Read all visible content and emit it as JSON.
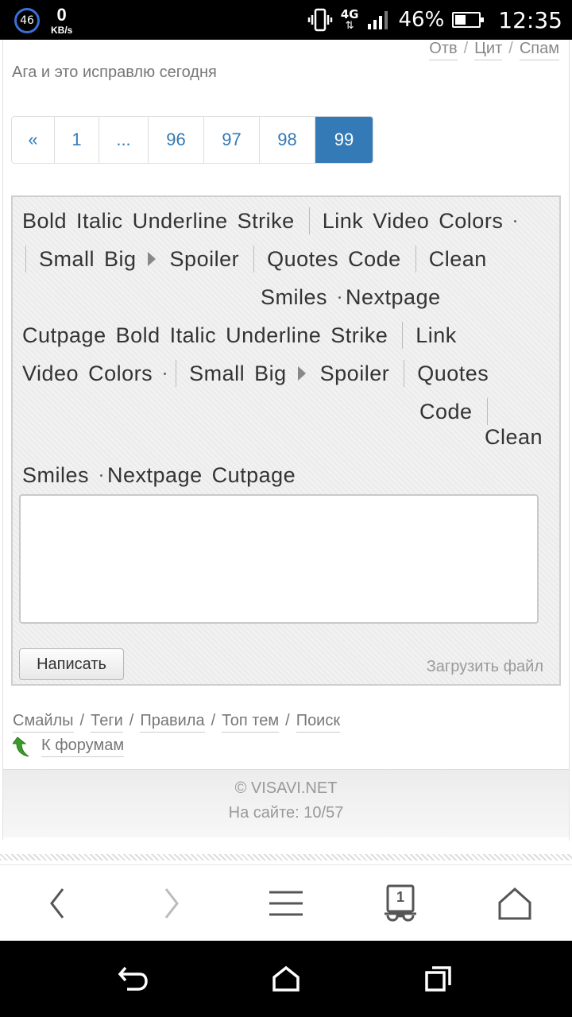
{
  "status_bar": {
    "notification_count": "46",
    "net_speed_value": "0",
    "net_speed_unit": "KB/s",
    "network_label": "4G",
    "battery_percent": "46%",
    "battery_level": 0.46,
    "time": "12:35"
  },
  "post": {
    "actions": [
      "Отв",
      "Цит",
      "Спам"
    ],
    "text": "Ага и это исправлю сегодня"
  },
  "pagination": {
    "items": [
      "«",
      "1",
      "...",
      "96",
      "97",
      "98",
      "99"
    ],
    "active": "99"
  },
  "toolbar": {
    "bold": "Bold",
    "italic": "Italic",
    "underline": "Underline",
    "strike": "Strike",
    "link": "Link",
    "video": "Video",
    "colors": "Colors",
    "small": "Small",
    "big": "Big",
    "spoiler": "Spoiler",
    "quotes": "Quotes",
    "code": "Code",
    "clean": "Clean",
    "smiles": "Smiles",
    "nextpage": "Nextpage",
    "cutpage": "Cutpage"
  },
  "form": {
    "submit_label": "Написать",
    "upload_label": "Загрузить файл"
  },
  "footer_links": [
    "Смайлы",
    "Теги",
    "Правила",
    "Топ тем",
    "Поиск"
  ],
  "back_to_forums": "К форумам",
  "site_footer": {
    "copyright": "© VISAVI.NET",
    "online": "На сайте: 10/57"
  },
  "browser_nav": {
    "tab_count": "1"
  }
}
